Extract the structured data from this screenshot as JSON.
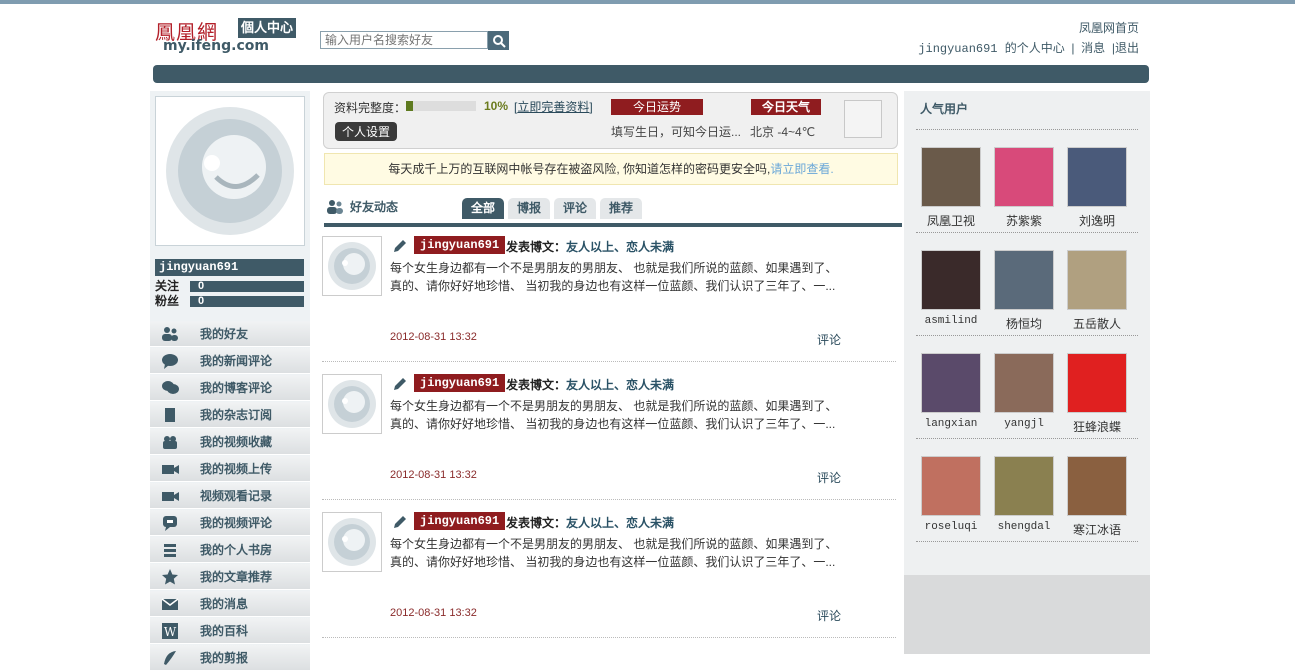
{
  "header": {
    "logo_cn": "鳳凰網",
    "logo_badge": "個人中心",
    "logo_url": "my.ifeng.com",
    "search_placeholder": "输入用户名搜索好友",
    "home_link": "凤凰网首页",
    "user_center": "jingyuan691 的个人中心",
    "messages": "消息",
    "logout": "退出"
  },
  "profile": {
    "username": "jingyuan691",
    "follow_label": "关注",
    "follow_count": "0",
    "fans_label": "粉丝",
    "fans_count": "0"
  },
  "menu": [
    {
      "label": "我的好友",
      "icon": "friends-icon"
    },
    {
      "label": "我的新闻评论",
      "icon": "comment-icon"
    },
    {
      "label": "我的博客评论",
      "icon": "chat-icon"
    },
    {
      "label": "我的杂志订阅",
      "icon": "magazine-icon"
    },
    {
      "label": "我的视频收藏",
      "icon": "video-collect-icon"
    },
    {
      "label": "我的视频上传",
      "icon": "video-upload-icon"
    },
    {
      "label": "视频观看记录",
      "icon": "video-history-icon"
    },
    {
      "label": "我的视频评论",
      "icon": "video-comment-icon"
    },
    {
      "label": "我的个人书房",
      "icon": "books-icon"
    },
    {
      "label": "我的文章推荐",
      "icon": "star-icon"
    },
    {
      "label": "我的消息",
      "icon": "mail-icon"
    },
    {
      "label": "我的百科",
      "icon": "wiki-icon"
    },
    {
      "label": "我的剪报",
      "icon": "clip-icon"
    }
  ],
  "completeness": {
    "label": "资料完整度：",
    "percent_value": 10,
    "percent_text": "10%",
    "complete_link": "立即完善资料",
    "settings_button": "个人设置",
    "fortune_label": "今日运势",
    "fortune_text": "填写生日，可知今日运...",
    "weather_label": "今日天气",
    "weather_text": "北京 -4~4℃"
  },
  "notice": {
    "text": "每天成千上万的互联网中帐号存在被盗风险, 你知道怎样的密码更安全吗,",
    "link": "请立即查看."
  },
  "feed": {
    "title": "好友动态",
    "tabs": [
      "全部",
      "博报",
      "评论",
      "推荐"
    ],
    "entries": [
      {
        "user": "jingyuan691",
        "action": "发表博文：",
        "title": "友人以上、恋人未满",
        "body": "每个女生身边都有一个不是男朋友的男朋友、 也就是我们所说的蓝颜、如果遇到了、真的、请你好好地珍惜、 当初我的身边也有这样一位蓝颜、我们认识了三年了、一...",
        "time": "2012-08-31 13:32",
        "comment": "评论"
      },
      {
        "user": "jingyuan691",
        "action": "发表博文：",
        "title": "友人以上、恋人未满",
        "body": "每个女生身边都有一个不是男朋友的男朋友、 也就是我们所说的蓝颜、如果遇到了、真的、请你好好地珍惜、 当初我的身边也有这样一位蓝颜、我们认识了三年了、一...",
        "time": "2012-08-31 13:32",
        "comment": "评论"
      },
      {
        "user": "jingyuan691",
        "action": "发表博文：",
        "title": "友人以上、恋人未满",
        "body": "每个女生身边都有一个不是男朋友的男朋友、 也就是我们所说的蓝颜、如果遇到了、真的、请你好好地珍惜、 当初我的身边也有这样一位蓝颜、我们认识了三年了、一...",
        "time": "2012-08-31 13:32",
        "comment": "评论"
      }
    ]
  },
  "popular": {
    "title": "人气用户",
    "users": [
      {
        "name": "凤凰卫视",
        "color": "#6a5a4a"
      },
      {
        "name": "苏紫紫",
        "color": "#d84a7a"
      },
      {
        "name": "刘逸明",
        "color": "#4a5a7a"
      },
      {
        "name": "asmilind",
        "color": "#3a2a2a"
      },
      {
        "name": "杨恒均",
        "color": "#5a6a7a"
      },
      {
        "name": "五岳散人",
        "color": "#b0a080"
      },
      {
        "name": "langxian",
        "color": "#5a4a6a"
      },
      {
        "name": "yangjl",
        "color": "#8a6a5a"
      },
      {
        "name": "狂蜂浪蝶",
        "color": "#e02020"
      },
      {
        "name": "roseluqi",
        "color": "#c07060"
      },
      {
        "name": "shengdal",
        "color": "#8a8050"
      },
      {
        "name": "寒江冰语",
        "color": "#8a6040"
      }
    ]
  }
}
